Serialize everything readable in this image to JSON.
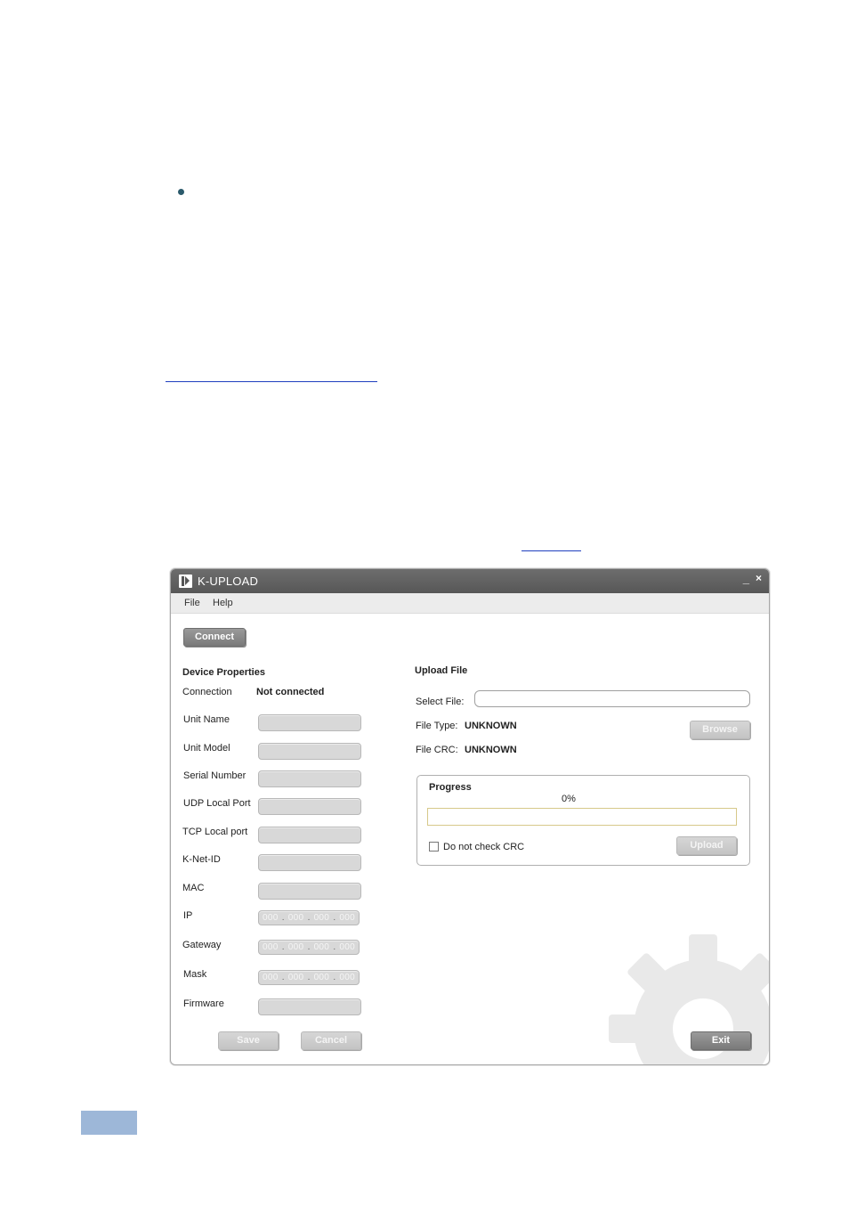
{
  "window": {
    "title": "K-UPLOAD",
    "minimize_glyph": "_",
    "close_glyph": "×"
  },
  "menu": {
    "items": [
      {
        "label": "File"
      },
      {
        "label": "Help"
      }
    ]
  },
  "connect_button": "Connect",
  "device_properties": {
    "heading": "Device Properties",
    "connection_label": "Connection",
    "connection_status": "Not connected",
    "fields": [
      {
        "label": "Unit Name"
      },
      {
        "label": "Unit Model"
      },
      {
        "label": "Serial Number"
      },
      {
        "label": "UDP Local Port"
      },
      {
        "label": "TCP Local port"
      },
      {
        "label": "K-Net-ID"
      },
      {
        "label": "MAC"
      }
    ],
    "ip_fields": [
      {
        "label": "IP",
        "segments": [
          "000",
          "000",
          "000",
          "000"
        ]
      },
      {
        "label": "Gateway",
        "segments": [
          "000",
          "000",
          "000",
          "000"
        ]
      },
      {
        "label": "Mask",
        "segments": [
          "000",
          "000",
          "000",
          "000"
        ]
      }
    ],
    "firmware_label": "Firmware",
    "save_button": "Save",
    "cancel_button": "Cancel"
  },
  "upload_file": {
    "heading": "Upload File",
    "select_file_label": "Select File:",
    "file_type_label": "File Type:",
    "file_type_value": "UNKNOWN",
    "file_crc_label": "File CRC:",
    "file_crc_value": "UNKNOWN",
    "browse_button": "Browse"
  },
  "progress": {
    "heading": "Progress",
    "percent_text": "0%",
    "value": 0,
    "checkbox_label": "Do not check CRC",
    "checkbox_checked": false,
    "upload_button": "Upload"
  },
  "exit_button": "Exit",
  "colors": {
    "titlebar": "#5f5f5f",
    "page_tab": "#9db7d8",
    "link": "#1f3fbf"
  },
  "icons": [
    "kramer-logo-icon",
    "minimize-icon",
    "close-icon",
    "gear-icon",
    "bullet-icon"
  ]
}
